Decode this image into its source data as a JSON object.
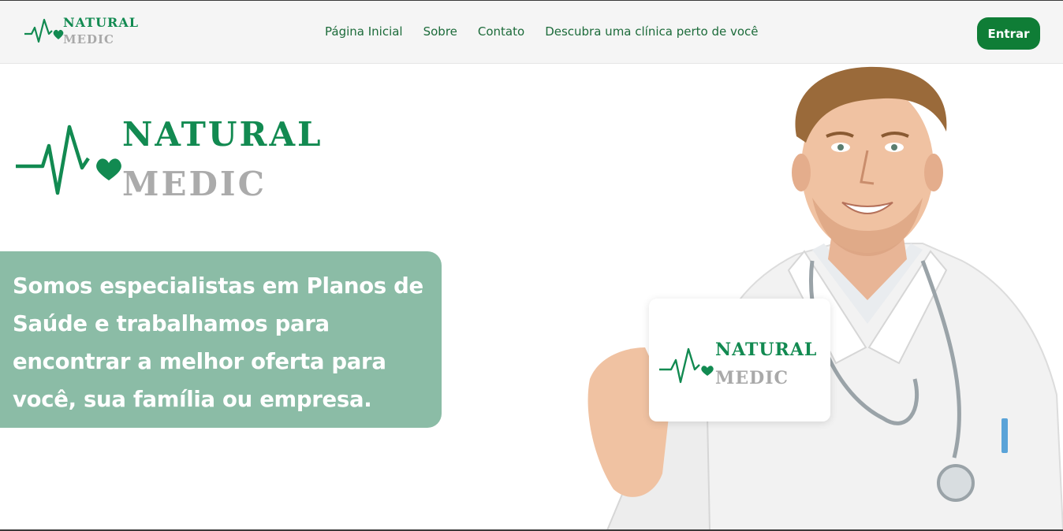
{
  "brand": {
    "word1": "NATURAL",
    "word2": "MEDIC",
    "logo_icon": "heartbeat-heart-icon",
    "green": "#128a51",
    "gray": "#ababab"
  },
  "nav": {
    "items": [
      {
        "label": "Página Inicial"
      },
      {
        "label": "Sobre"
      },
      {
        "label": "Contato"
      },
      {
        "label": "Descubra uma clínica perto de você"
      }
    ]
  },
  "header": {
    "login_label": "Entrar",
    "login_color": "#0f7d36"
  },
  "hero": {
    "tagline": "Somos especialistas em Planos de Saúde e trabalhamos para encontrar a melhor oferta para você, sua família ou empresa.",
    "tagline_bg": "#8bbca6"
  }
}
